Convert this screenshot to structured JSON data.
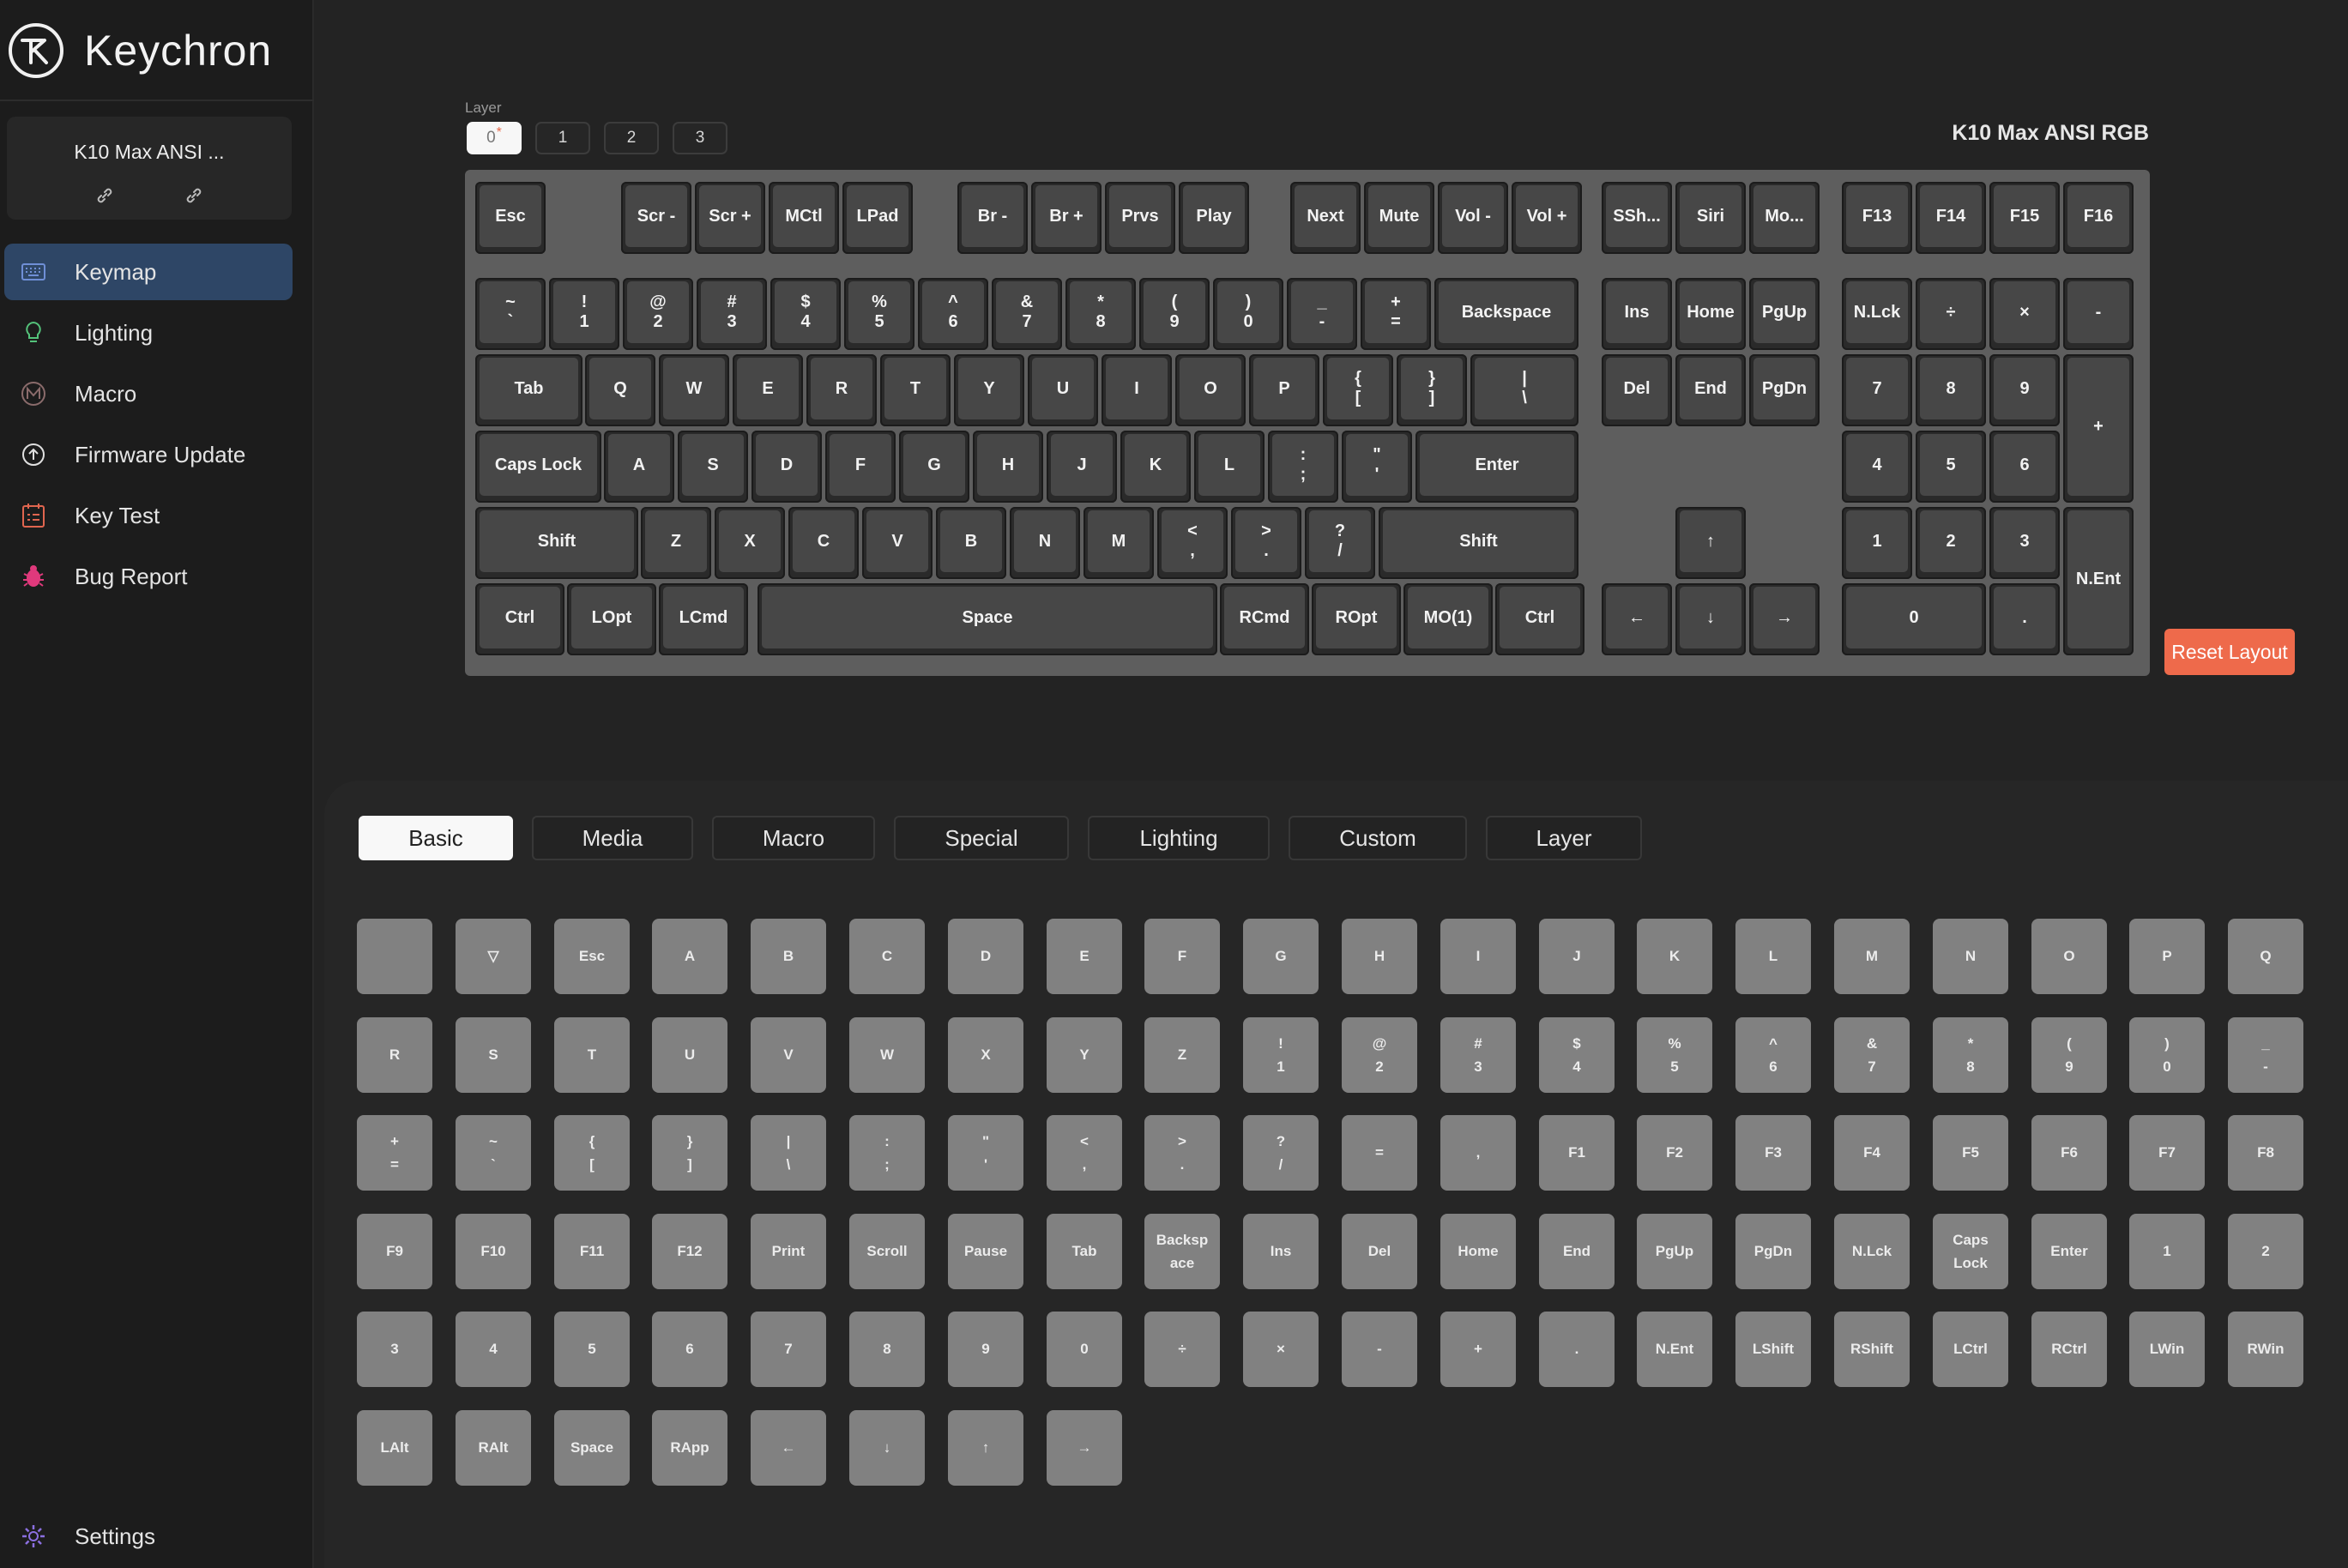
{
  "sidebar": {
    "brand": "Keychron",
    "device_name": "K10 Max ANSI ...",
    "nav": [
      {
        "label": "Keymap",
        "icon": "keyboard-icon",
        "active": true
      },
      {
        "label": "Lighting",
        "icon": "lightbulb-icon",
        "active": false
      },
      {
        "label": "Macro",
        "icon": "macro-icon",
        "active": false
      },
      {
        "label": "Firmware Update",
        "icon": "firmware-update-icon",
        "active": false
      },
      {
        "label": "Key Test",
        "icon": "key-test-icon",
        "active": false
      },
      {
        "label": "Bug Report",
        "icon": "bug-icon",
        "active": false
      }
    ],
    "settings_label": "Settings"
  },
  "layers": {
    "label": "Layer",
    "items": [
      "0",
      "1",
      "2",
      "3"
    ],
    "active": "0",
    "modified_marker": "*"
  },
  "keyboard_title": "K10 Max ANSI RGB",
  "keyboard": {
    "rows": [
      [
        "Esc",
        "Scr -",
        "Scr +",
        "MCtl",
        "LPad",
        "Br -",
        "Br +",
        "Prvs",
        "Play",
        "Next",
        "Mute",
        "Vol -",
        "Vol +",
        "SSh...",
        "Siri",
        "Mo...",
        "F13",
        "F14",
        "F15",
        "F16"
      ],
      [
        "~\n`",
        "!\n1",
        "@\n2",
        "#\n3",
        "$\n4",
        "%\n5",
        "^\n6",
        "&\n7",
        "*\n8",
        "(\n9",
        ")\n0",
        "_\n-",
        "+\n=",
        "Backspace",
        "Ins",
        "Home",
        "PgUp",
        "N.Lck",
        "÷",
        "×",
        "-"
      ],
      [
        "Tab",
        "Q",
        "W",
        "E",
        "R",
        "T",
        "Y",
        "U",
        "I",
        "O",
        "P",
        "{\n[",
        "}\n]",
        "|\n\\",
        "Del",
        "End",
        "PgDn",
        "7",
        "8",
        "9",
        "+"
      ],
      [
        "Caps Lock",
        "A",
        "S",
        "D",
        "F",
        "G",
        "H",
        "J",
        "K",
        "L",
        ":\n;",
        "\"\n'",
        "Enter",
        "4",
        "5",
        "6"
      ],
      [
        "Shift",
        "Z",
        "X",
        "C",
        "V",
        "B",
        "N",
        "M",
        "<\n,",
        ">\n.",
        "?\n/",
        "Shift",
        "↑",
        "1",
        "2",
        "3",
        "N.Ent"
      ],
      [
        "Ctrl",
        "LOpt",
        "LCmd",
        "Space",
        "RCmd",
        "ROpt",
        "MO(1)",
        "Ctrl",
        "←",
        "↓",
        "→",
        "0",
        "."
      ]
    ]
  },
  "reset_label": "Reset Layout",
  "tabs": [
    "Basic",
    "Media",
    "Macro",
    "Special",
    "Lighting",
    "Custom",
    "Layer"
  ],
  "active_tab": "Basic",
  "palette": [
    [
      "",
      "▽",
      "Esc",
      "A",
      "B",
      "C",
      "D",
      "E",
      "F",
      "G",
      "H",
      "I",
      "J",
      "K",
      "L",
      "M",
      "N",
      "O",
      "P",
      "Q"
    ],
    [
      "R",
      "S",
      "T",
      "U",
      "V",
      "W",
      "X",
      "Y",
      "Z",
      "!\n1",
      "@\n2",
      "#\n3",
      "$\n4",
      "%\n5",
      "^\n6",
      "&\n7",
      "*\n8",
      "(\n9",
      ")\n0",
      "_\n-"
    ],
    [
      "+\n=",
      "~\n`",
      "{\n[",
      "}\n]",
      "|\n\\",
      ":\n;",
      "\"\n'",
      "<\n,",
      ">\n.",
      "?\n/",
      "=",
      ",",
      "F1",
      "F2",
      "F3",
      "F4",
      "F5",
      "F6",
      "F7",
      "F8"
    ],
    [
      "F9",
      "F10",
      "F11",
      "F12",
      "Print",
      "Scroll",
      "Pause",
      "Tab",
      "Backsp\nace",
      "Ins",
      "Del",
      "Home",
      "End",
      "PgUp",
      "PgDn",
      "N.Lck",
      "Caps\nLock",
      "Enter",
      "1",
      "2"
    ],
    [
      "3",
      "4",
      "5",
      "6",
      "7",
      "8",
      "9",
      "0",
      "÷",
      "×",
      "-",
      "+",
      ".",
      "N.Ent",
      "LShift",
      "RShift",
      "LCtrl",
      "RCtrl",
      "LWin",
      "RWin"
    ],
    [
      "LAlt",
      "RAlt",
      "Space",
      "RApp",
      "←",
      "↓",
      "↑",
      "→"
    ]
  ],
  "colors": {
    "accent_reset": "#ee6a4b",
    "nav_active": "#2e4666",
    "layer_marker": "#e8694a"
  }
}
